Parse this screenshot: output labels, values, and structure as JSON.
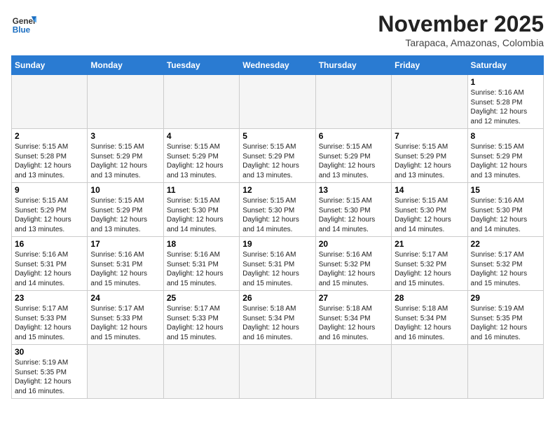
{
  "logo": {
    "general": "General",
    "blue": "Blue"
  },
  "title": "November 2025",
  "subtitle": "Tarapaca, Amazonas, Colombia",
  "days_of_week": [
    "Sunday",
    "Monday",
    "Tuesday",
    "Wednesday",
    "Thursday",
    "Friday",
    "Saturday"
  ],
  "weeks": [
    [
      {
        "day": null,
        "info": null
      },
      {
        "day": null,
        "info": null
      },
      {
        "day": null,
        "info": null
      },
      {
        "day": null,
        "info": null
      },
      {
        "day": null,
        "info": null
      },
      {
        "day": null,
        "info": null
      },
      {
        "day": "1",
        "info": "Sunrise: 5:16 AM\nSunset: 5:28 PM\nDaylight: 12 hours and 12 minutes."
      }
    ],
    [
      {
        "day": "2",
        "info": "Sunrise: 5:15 AM\nSunset: 5:28 PM\nDaylight: 12 hours and 13 minutes."
      },
      {
        "day": "3",
        "info": "Sunrise: 5:15 AM\nSunset: 5:29 PM\nDaylight: 12 hours and 13 minutes."
      },
      {
        "day": "4",
        "info": "Sunrise: 5:15 AM\nSunset: 5:29 PM\nDaylight: 12 hours and 13 minutes."
      },
      {
        "day": "5",
        "info": "Sunrise: 5:15 AM\nSunset: 5:29 PM\nDaylight: 12 hours and 13 minutes."
      },
      {
        "day": "6",
        "info": "Sunrise: 5:15 AM\nSunset: 5:29 PM\nDaylight: 12 hours and 13 minutes."
      },
      {
        "day": "7",
        "info": "Sunrise: 5:15 AM\nSunset: 5:29 PM\nDaylight: 12 hours and 13 minutes."
      },
      {
        "day": "8",
        "info": "Sunrise: 5:15 AM\nSunset: 5:29 PM\nDaylight: 12 hours and 13 minutes."
      }
    ],
    [
      {
        "day": "9",
        "info": "Sunrise: 5:15 AM\nSunset: 5:29 PM\nDaylight: 12 hours and 13 minutes."
      },
      {
        "day": "10",
        "info": "Sunrise: 5:15 AM\nSunset: 5:29 PM\nDaylight: 12 hours and 13 minutes."
      },
      {
        "day": "11",
        "info": "Sunrise: 5:15 AM\nSunset: 5:30 PM\nDaylight: 12 hours and 14 minutes."
      },
      {
        "day": "12",
        "info": "Sunrise: 5:15 AM\nSunset: 5:30 PM\nDaylight: 12 hours and 14 minutes."
      },
      {
        "day": "13",
        "info": "Sunrise: 5:15 AM\nSunset: 5:30 PM\nDaylight: 12 hours and 14 minutes."
      },
      {
        "day": "14",
        "info": "Sunrise: 5:15 AM\nSunset: 5:30 PM\nDaylight: 12 hours and 14 minutes."
      },
      {
        "day": "15",
        "info": "Sunrise: 5:16 AM\nSunset: 5:30 PM\nDaylight: 12 hours and 14 minutes."
      }
    ],
    [
      {
        "day": "16",
        "info": "Sunrise: 5:16 AM\nSunset: 5:31 PM\nDaylight: 12 hours and 14 minutes."
      },
      {
        "day": "17",
        "info": "Sunrise: 5:16 AM\nSunset: 5:31 PM\nDaylight: 12 hours and 15 minutes."
      },
      {
        "day": "18",
        "info": "Sunrise: 5:16 AM\nSunset: 5:31 PM\nDaylight: 12 hours and 15 minutes."
      },
      {
        "day": "19",
        "info": "Sunrise: 5:16 AM\nSunset: 5:31 PM\nDaylight: 12 hours and 15 minutes."
      },
      {
        "day": "20",
        "info": "Sunrise: 5:16 AM\nSunset: 5:32 PM\nDaylight: 12 hours and 15 minutes."
      },
      {
        "day": "21",
        "info": "Sunrise: 5:17 AM\nSunset: 5:32 PM\nDaylight: 12 hours and 15 minutes."
      },
      {
        "day": "22",
        "info": "Sunrise: 5:17 AM\nSunset: 5:32 PM\nDaylight: 12 hours and 15 minutes."
      }
    ],
    [
      {
        "day": "23",
        "info": "Sunrise: 5:17 AM\nSunset: 5:33 PM\nDaylight: 12 hours and 15 minutes."
      },
      {
        "day": "24",
        "info": "Sunrise: 5:17 AM\nSunset: 5:33 PM\nDaylight: 12 hours and 15 minutes."
      },
      {
        "day": "25",
        "info": "Sunrise: 5:17 AM\nSunset: 5:33 PM\nDaylight: 12 hours and 15 minutes."
      },
      {
        "day": "26",
        "info": "Sunrise: 5:18 AM\nSunset: 5:34 PM\nDaylight: 12 hours and 16 minutes."
      },
      {
        "day": "27",
        "info": "Sunrise: 5:18 AM\nSunset: 5:34 PM\nDaylight: 12 hours and 16 minutes."
      },
      {
        "day": "28",
        "info": "Sunrise: 5:18 AM\nSunset: 5:34 PM\nDaylight: 12 hours and 16 minutes."
      },
      {
        "day": "29",
        "info": "Sunrise: 5:19 AM\nSunset: 5:35 PM\nDaylight: 12 hours and 16 minutes."
      }
    ],
    [
      {
        "day": "30",
        "info": "Sunrise: 5:19 AM\nSunset: 5:35 PM\nDaylight: 12 hours and 16 minutes."
      },
      {
        "day": null,
        "info": null
      },
      {
        "day": null,
        "info": null
      },
      {
        "day": null,
        "info": null
      },
      {
        "day": null,
        "info": null
      },
      {
        "day": null,
        "info": null
      },
      {
        "day": null,
        "info": null
      }
    ]
  ]
}
